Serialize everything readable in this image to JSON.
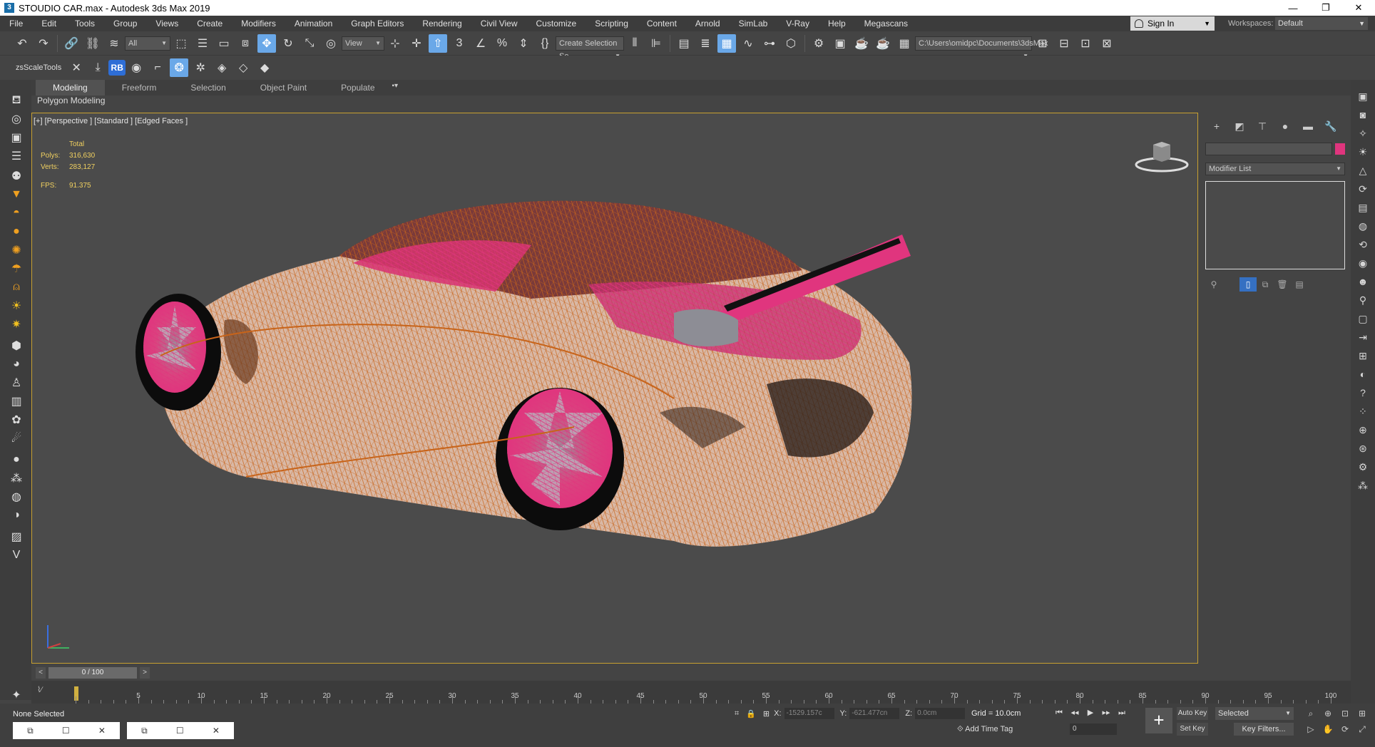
{
  "window": {
    "title": "STOUDIO  CAR.max - Autodesk 3ds Max 2019",
    "minimize": "—",
    "restore": "❐",
    "close": "✕"
  },
  "menu": {
    "items": [
      "File",
      "Edit",
      "Tools",
      "Group",
      "Views",
      "Create",
      "Modifiers",
      "Animation",
      "Graph Editors",
      "Rendering",
      "Civil View",
      "Customize",
      "Scripting",
      "Content",
      "Arnold",
      "SimLab",
      "V-Ray",
      "Help",
      "Megascans"
    ],
    "sign_in": "Sign In",
    "workspaces_label": "Workspaces:",
    "workspace_value": "Default"
  },
  "toolbar": {
    "selection_filter": "All",
    "ref_coord": "View",
    "selection_set": "Create Selection Se",
    "project_path": "C:\\Users\\omidpc\\Documents\\3dsMax",
    "zs_label": "zsScaleTools",
    "rb_label": "RB"
  },
  "ribbon": {
    "tabs": [
      "Modeling",
      "Freeform",
      "Selection",
      "Object Paint",
      "Populate"
    ],
    "active": "Modeling",
    "sub_label": "Polygon Modeling"
  },
  "viewport": {
    "label": "[+] [Perspective ] [Standard ] [Edged Faces ]",
    "stats": {
      "header": "Total",
      "polys_label": "Polys:",
      "polys": "316,630",
      "verts_label": "Verts:",
      "verts": "283,127",
      "fps_label": "FPS:",
      "fps": "91.375"
    },
    "wire_color": "#e07a1e",
    "selection_color": "#e0357e",
    "body_color": "#d8b9a8"
  },
  "command_panel": {
    "modifier_list": "Modifier List",
    "object_color": "#e0357e"
  },
  "timeline": {
    "frame_display": "0 / 100",
    "prev": "<",
    "next": ">",
    "tick_labels": [
      "5",
      "10",
      "15",
      "20",
      "25",
      "30",
      "35",
      "40",
      "45",
      "50",
      "55",
      "60",
      "65",
      "70",
      "75",
      "80",
      "85",
      "90",
      "95",
      "100"
    ]
  },
  "status": {
    "selection": "None Selected",
    "x_label": "X:",
    "x_value": "-1529.157c",
    "y_label": "Y:",
    "y_value": "-621.477cn",
    "z_label": "Z:",
    "z_value": "0.0cm",
    "grid": "Grid = 10.0cm",
    "add_time_tag": "Add Time Tag",
    "current_frame": "0",
    "auto_key": "Auto Key",
    "set_key": "Set Key",
    "key_mode": "Selected",
    "key_filters": "Key Filters..."
  }
}
